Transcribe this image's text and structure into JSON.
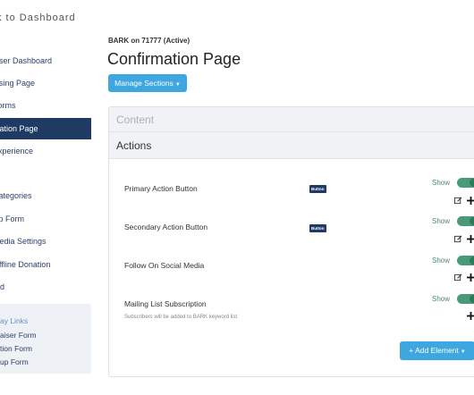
{
  "sidebar": {
    "back_link": "k to Dashboard",
    "items": [
      {
        "label": "aiser Dashboard"
      },
      {
        "label": "aising Page"
      },
      {
        "label": "Forms"
      },
      {
        "label": "mation Page"
      },
      {
        "label": "Experience"
      },
      {
        "label": "Categories"
      },
      {
        "label": "Up Form"
      },
      {
        "label": "Media Settings"
      },
      {
        "label": "Offline Donation"
      },
      {
        "label": "ord"
      }
    ],
    "quick_links": {
      "title": "ay Links",
      "items": [
        {
          "label": "aiser Form"
        },
        {
          "label": "tion Form"
        },
        {
          "label": "up Form"
        }
      ]
    }
  },
  "header": {
    "subtitle": "BARK on 71777 (Active)",
    "title": "Confirmation Page",
    "manage_button": "Manage Sections"
  },
  "panel": {
    "content_label": "Content",
    "actions_label": "Actions",
    "rows": [
      {
        "title": "Primary Action Button",
        "badge": "Button",
        "show_label": "Show",
        "toggle_on": true
      },
      {
        "title": "Secondary Action Button",
        "badge": "Button",
        "show_label": "Show",
        "toggle_on": true
      },
      {
        "title": "Follow On Social Media",
        "show_label": "Show",
        "toggle_on": true
      },
      {
        "title": "Mailing List Subscription",
        "subtitle": "Subscribers will be added to BARK keyword list",
        "show_label": "Show",
        "toggle_on": true
      }
    ],
    "add_button": "+ Add Element"
  },
  "colors": {
    "accent": "#3ea7e0",
    "nav_active": "#1f3a63",
    "toggle": "#4a9a7a"
  }
}
